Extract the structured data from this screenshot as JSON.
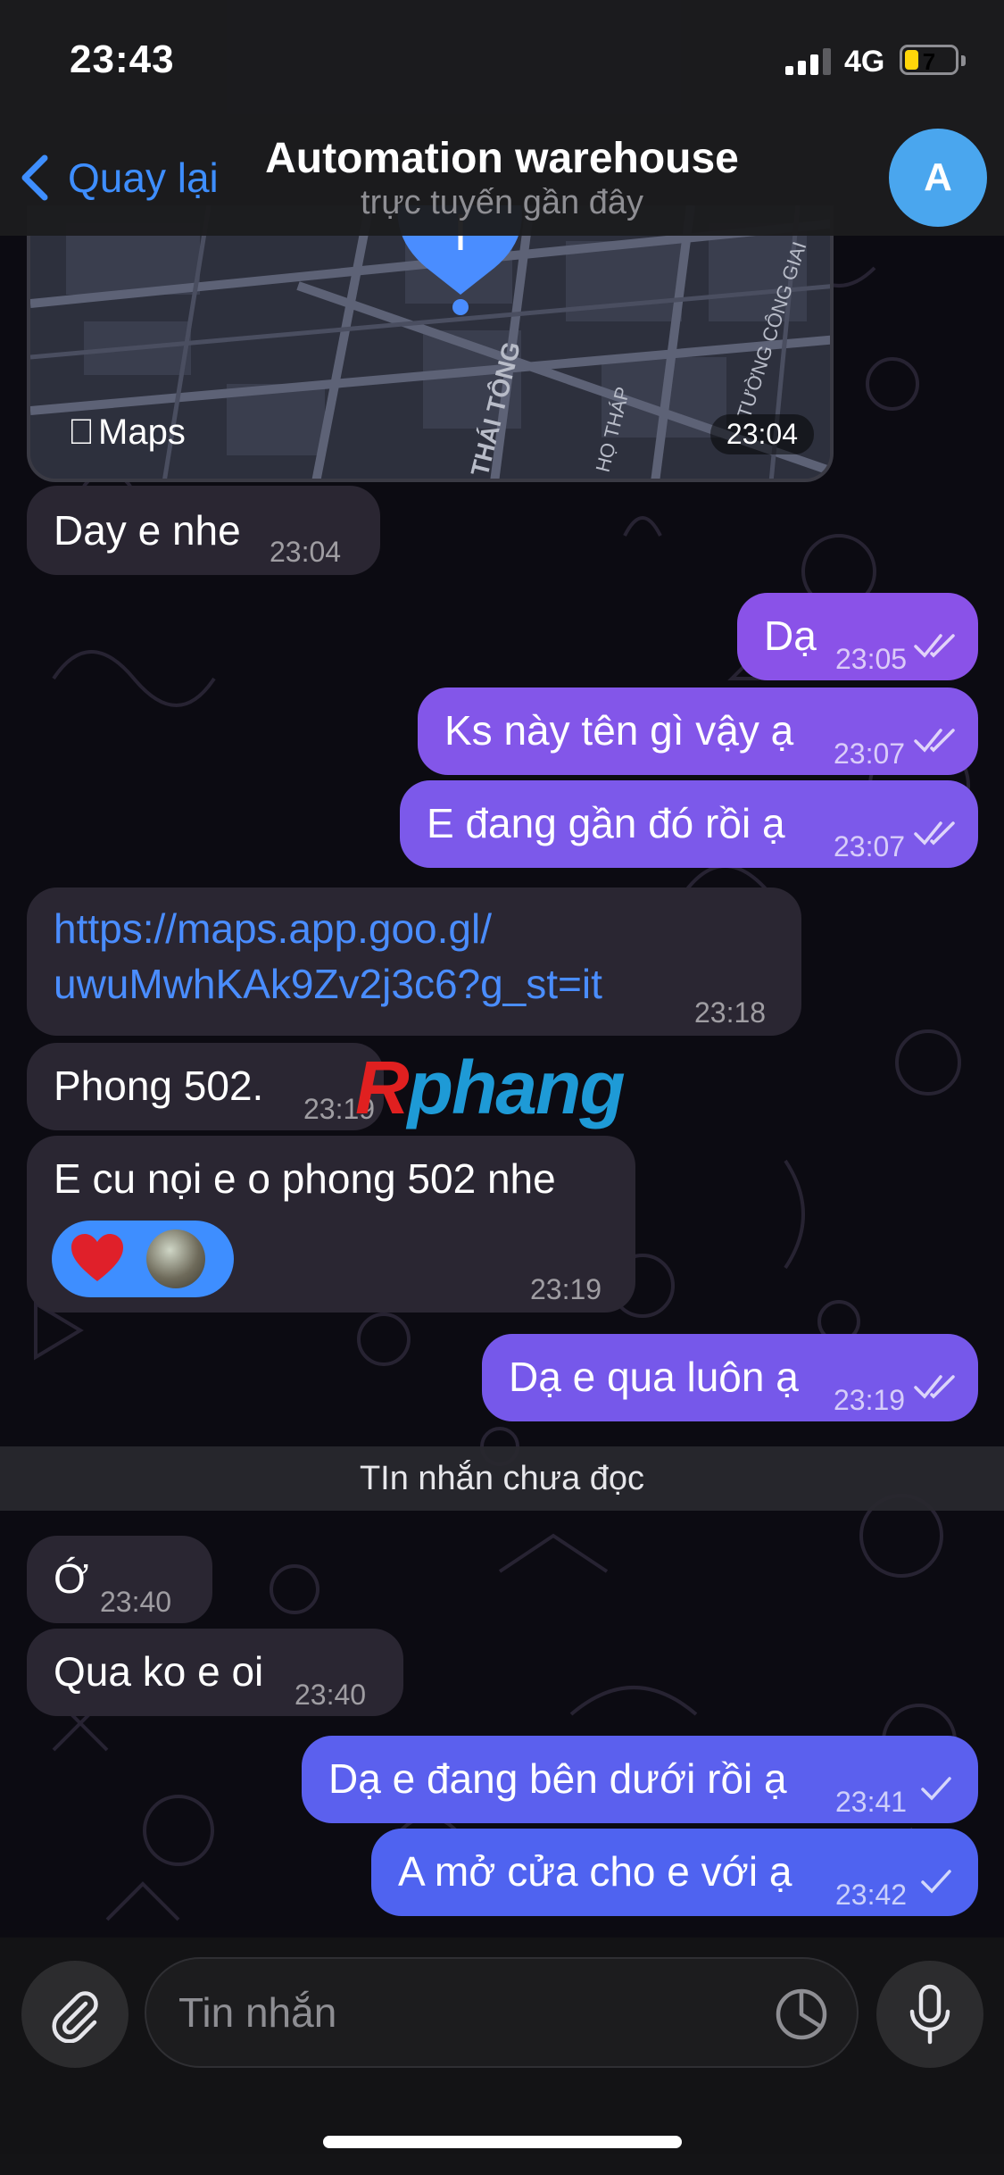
{
  "status_bar": {
    "time": "23:43",
    "network": "4G",
    "battery": "7"
  },
  "header": {
    "back_label": "Quay lại",
    "title": "Automation warehouse",
    "subtitle": "trực tuyến gần đây",
    "avatar_letter": "A",
    "avatar_color": "#4aa6ee"
  },
  "map_message": {
    "brand": "Maps",
    "time": "23:04",
    "street_labels": [
      "THÁI TÔNG",
      "HỌ THÁP",
      "TƯỜNG CÔNG GIAI"
    ]
  },
  "messages": [
    {
      "direction": "in",
      "text": "Day e nhe",
      "time": "23:04"
    },
    {
      "direction": "out",
      "text": "Dạ",
      "time": "23:05",
      "status": "read"
    },
    {
      "direction": "out",
      "text": "Ks này tên gì vậy ạ",
      "time": "23:07",
      "status": "read"
    },
    {
      "direction": "out",
      "text": "E đang gần đó rồi ạ",
      "time": "23:07",
      "status": "read"
    },
    {
      "direction": "in",
      "link_line1": "https://maps.app.goo.gl/",
      "link_line2": "uwuMwhKAk9Zv2j3c6?g_st=it",
      "time": "23:18"
    },
    {
      "direction": "in",
      "text": "Phong 502.",
      "time": "23:19"
    },
    {
      "direction": "in",
      "text": "E cu nọi e o phong 502 nhe",
      "time": "23:19",
      "reactions": [
        "heart-icon"
      ]
    },
    {
      "direction": "out",
      "text": "Dạ e qua luôn ạ",
      "time": "23:19",
      "status": "read"
    },
    {
      "direction": "in",
      "text": "Ớ",
      "time": "23:40"
    },
    {
      "direction": "in",
      "text": "Qua ko e oi",
      "time": "23:40"
    },
    {
      "direction": "out",
      "text": "Dạ e đang bên dưới rồi ạ",
      "time": "23:41",
      "status": "sent"
    },
    {
      "direction": "out",
      "text": "A mở cửa cho e với ạ",
      "time": "23:42",
      "status": "sent"
    }
  ],
  "unread_divider": "TIn nhắn chưa đọc",
  "watermark": {
    "first": "R",
    "rest": "phang"
  },
  "input": {
    "placeholder": "Tin nhắn"
  },
  "colors": {
    "outgoing_top": "#8a52e8",
    "outgoing_bottom": "#4f63f0",
    "incoming": "#2a2632",
    "accent": "#3e8eff"
  },
  "icons": [
    "chevron-left-icon",
    "signal-icon",
    "battery-icon",
    "map-pin-icon",
    "apple-logo-icon",
    "double-check-icon",
    "single-check-icon",
    "heart-icon",
    "paperclip-icon",
    "sticker-icon",
    "microphone-icon"
  ]
}
